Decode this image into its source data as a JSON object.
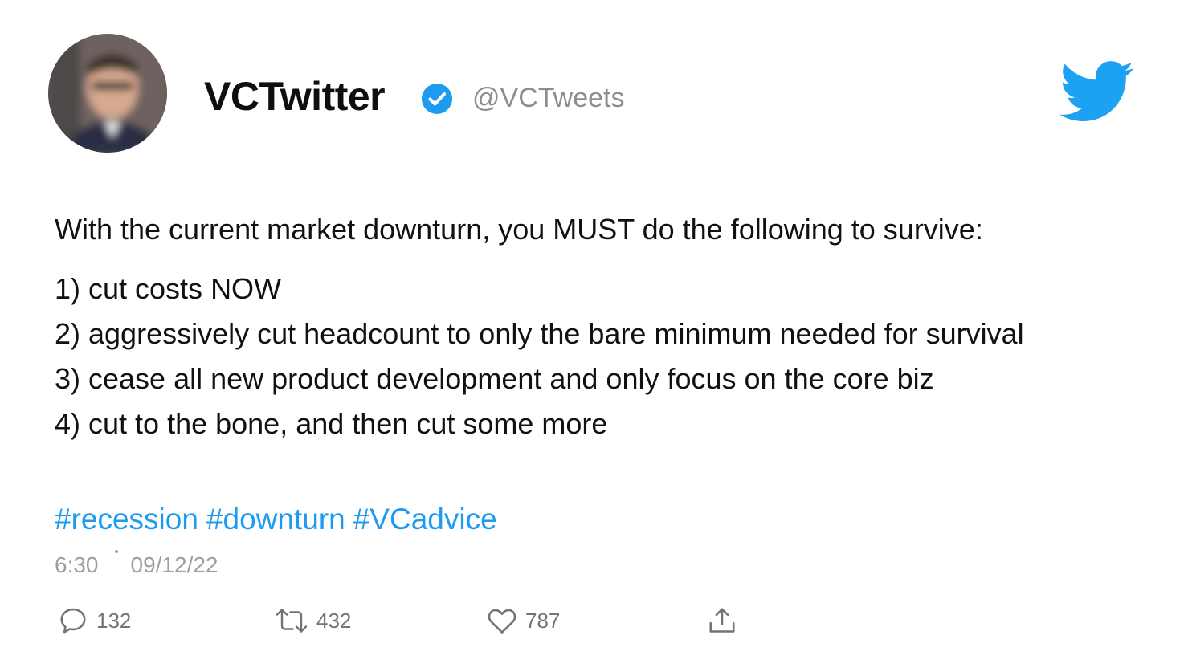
{
  "author": {
    "display_name": "VCTwitter",
    "handle": "@VCTweets",
    "verified": true,
    "avatar_icon": "profile-photo"
  },
  "brand": {
    "logo_icon": "twitter-bird-icon",
    "color": "#1d9bf0"
  },
  "tweet": {
    "intro": "With the current market downturn, you MUST do the following to survive:",
    "items": [
      "1) cut costs NOW",
      "2) aggressively cut headcount to only the bare minimum needed for survival",
      "3) cease all new product development and only focus on the core biz",
      "4) cut to the bone, and then cut some more"
    ],
    "hashtags": [
      "#recession",
      "#downturn",
      "#VCadvice"
    ],
    "time": "6:30",
    "date": "09/12/22"
  },
  "actions": {
    "reply": {
      "icon": "reply-icon",
      "count": "132"
    },
    "retweet": {
      "icon": "retweet-icon",
      "count": "432"
    },
    "like": {
      "icon": "heart-icon",
      "count": "787"
    },
    "share": {
      "icon": "share-icon"
    }
  },
  "colors": {
    "text": "#111111",
    "muted": "#8a8f93",
    "link": "#1d9bf0",
    "verified": "#1d9bf0",
    "background": "#ffffff"
  }
}
